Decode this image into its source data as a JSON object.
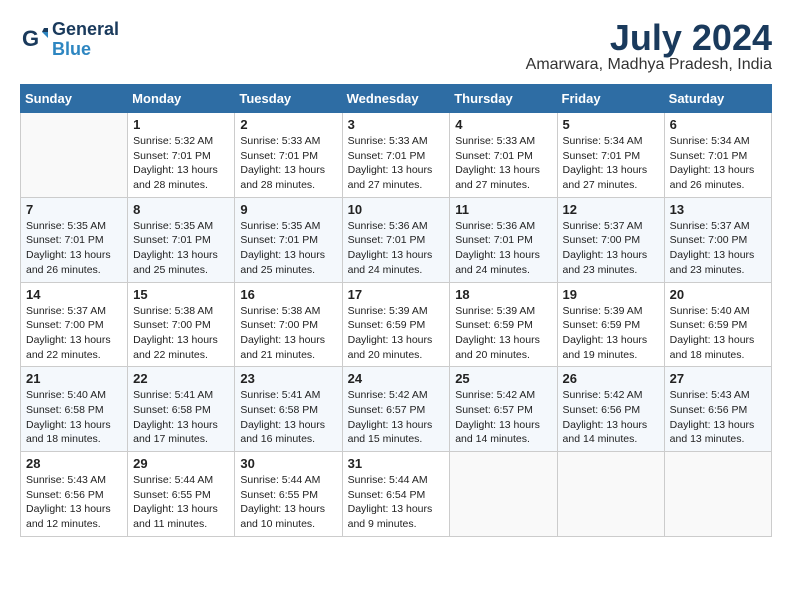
{
  "header": {
    "logo_line1": "General",
    "logo_line2": "Blue",
    "month_year": "July 2024",
    "location": "Amarwara, Madhya Pradesh, India"
  },
  "weekdays": [
    "Sunday",
    "Monday",
    "Tuesday",
    "Wednesday",
    "Thursday",
    "Friday",
    "Saturday"
  ],
  "weeks": [
    [
      {
        "num": "",
        "info": ""
      },
      {
        "num": "1",
        "info": "Sunrise: 5:32 AM\nSunset: 7:01 PM\nDaylight: 13 hours\nand 28 minutes."
      },
      {
        "num": "2",
        "info": "Sunrise: 5:33 AM\nSunset: 7:01 PM\nDaylight: 13 hours\nand 28 minutes."
      },
      {
        "num": "3",
        "info": "Sunrise: 5:33 AM\nSunset: 7:01 PM\nDaylight: 13 hours\nand 27 minutes."
      },
      {
        "num": "4",
        "info": "Sunrise: 5:33 AM\nSunset: 7:01 PM\nDaylight: 13 hours\nand 27 minutes."
      },
      {
        "num": "5",
        "info": "Sunrise: 5:34 AM\nSunset: 7:01 PM\nDaylight: 13 hours\nand 27 minutes."
      },
      {
        "num": "6",
        "info": "Sunrise: 5:34 AM\nSunset: 7:01 PM\nDaylight: 13 hours\nand 26 minutes."
      }
    ],
    [
      {
        "num": "7",
        "info": "Sunrise: 5:35 AM\nSunset: 7:01 PM\nDaylight: 13 hours\nand 26 minutes."
      },
      {
        "num": "8",
        "info": "Sunrise: 5:35 AM\nSunset: 7:01 PM\nDaylight: 13 hours\nand 25 minutes."
      },
      {
        "num": "9",
        "info": "Sunrise: 5:35 AM\nSunset: 7:01 PM\nDaylight: 13 hours\nand 25 minutes."
      },
      {
        "num": "10",
        "info": "Sunrise: 5:36 AM\nSunset: 7:01 PM\nDaylight: 13 hours\nand 24 minutes."
      },
      {
        "num": "11",
        "info": "Sunrise: 5:36 AM\nSunset: 7:01 PM\nDaylight: 13 hours\nand 24 minutes."
      },
      {
        "num": "12",
        "info": "Sunrise: 5:37 AM\nSunset: 7:00 PM\nDaylight: 13 hours\nand 23 minutes."
      },
      {
        "num": "13",
        "info": "Sunrise: 5:37 AM\nSunset: 7:00 PM\nDaylight: 13 hours\nand 23 minutes."
      }
    ],
    [
      {
        "num": "14",
        "info": "Sunrise: 5:37 AM\nSunset: 7:00 PM\nDaylight: 13 hours\nand 22 minutes."
      },
      {
        "num": "15",
        "info": "Sunrise: 5:38 AM\nSunset: 7:00 PM\nDaylight: 13 hours\nand 22 minutes."
      },
      {
        "num": "16",
        "info": "Sunrise: 5:38 AM\nSunset: 7:00 PM\nDaylight: 13 hours\nand 21 minutes."
      },
      {
        "num": "17",
        "info": "Sunrise: 5:39 AM\nSunset: 6:59 PM\nDaylight: 13 hours\nand 20 minutes."
      },
      {
        "num": "18",
        "info": "Sunrise: 5:39 AM\nSunset: 6:59 PM\nDaylight: 13 hours\nand 20 minutes."
      },
      {
        "num": "19",
        "info": "Sunrise: 5:39 AM\nSunset: 6:59 PM\nDaylight: 13 hours\nand 19 minutes."
      },
      {
        "num": "20",
        "info": "Sunrise: 5:40 AM\nSunset: 6:59 PM\nDaylight: 13 hours\nand 18 minutes."
      }
    ],
    [
      {
        "num": "21",
        "info": "Sunrise: 5:40 AM\nSunset: 6:58 PM\nDaylight: 13 hours\nand 18 minutes."
      },
      {
        "num": "22",
        "info": "Sunrise: 5:41 AM\nSunset: 6:58 PM\nDaylight: 13 hours\nand 17 minutes."
      },
      {
        "num": "23",
        "info": "Sunrise: 5:41 AM\nSunset: 6:58 PM\nDaylight: 13 hours\nand 16 minutes."
      },
      {
        "num": "24",
        "info": "Sunrise: 5:42 AM\nSunset: 6:57 PM\nDaylight: 13 hours\nand 15 minutes."
      },
      {
        "num": "25",
        "info": "Sunrise: 5:42 AM\nSunset: 6:57 PM\nDaylight: 13 hours\nand 14 minutes."
      },
      {
        "num": "26",
        "info": "Sunrise: 5:42 AM\nSunset: 6:56 PM\nDaylight: 13 hours\nand 14 minutes."
      },
      {
        "num": "27",
        "info": "Sunrise: 5:43 AM\nSunset: 6:56 PM\nDaylight: 13 hours\nand 13 minutes."
      }
    ],
    [
      {
        "num": "28",
        "info": "Sunrise: 5:43 AM\nSunset: 6:56 PM\nDaylight: 13 hours\nand 12 minutes."
      },
      {
        "num": "29",
        "info": "Sunrise: 5:44 AM\nSunset: 6:55 PM\nDaylight: 13 hours\nand 11 minutes."
      },
      {
        "num": "30",
        "info": "Sunrise: 5:44 AM\nSunset: 6:55 PM\nDaylight: 13 hours\nand 10 minutes."
      },
      {
        "num": "31",
        "info": "Sunrise: 5:44 AM\nSunset: 6:54 PM\nDaylight: 13 hours\nand 9 minutes."
      },
      {
        "num": "",
        "info": ""
      },
      {
        "num": "",
        "info": ""
      },
      {
        "num": "",
        "info": ""
      }
    ]
  ]
}
